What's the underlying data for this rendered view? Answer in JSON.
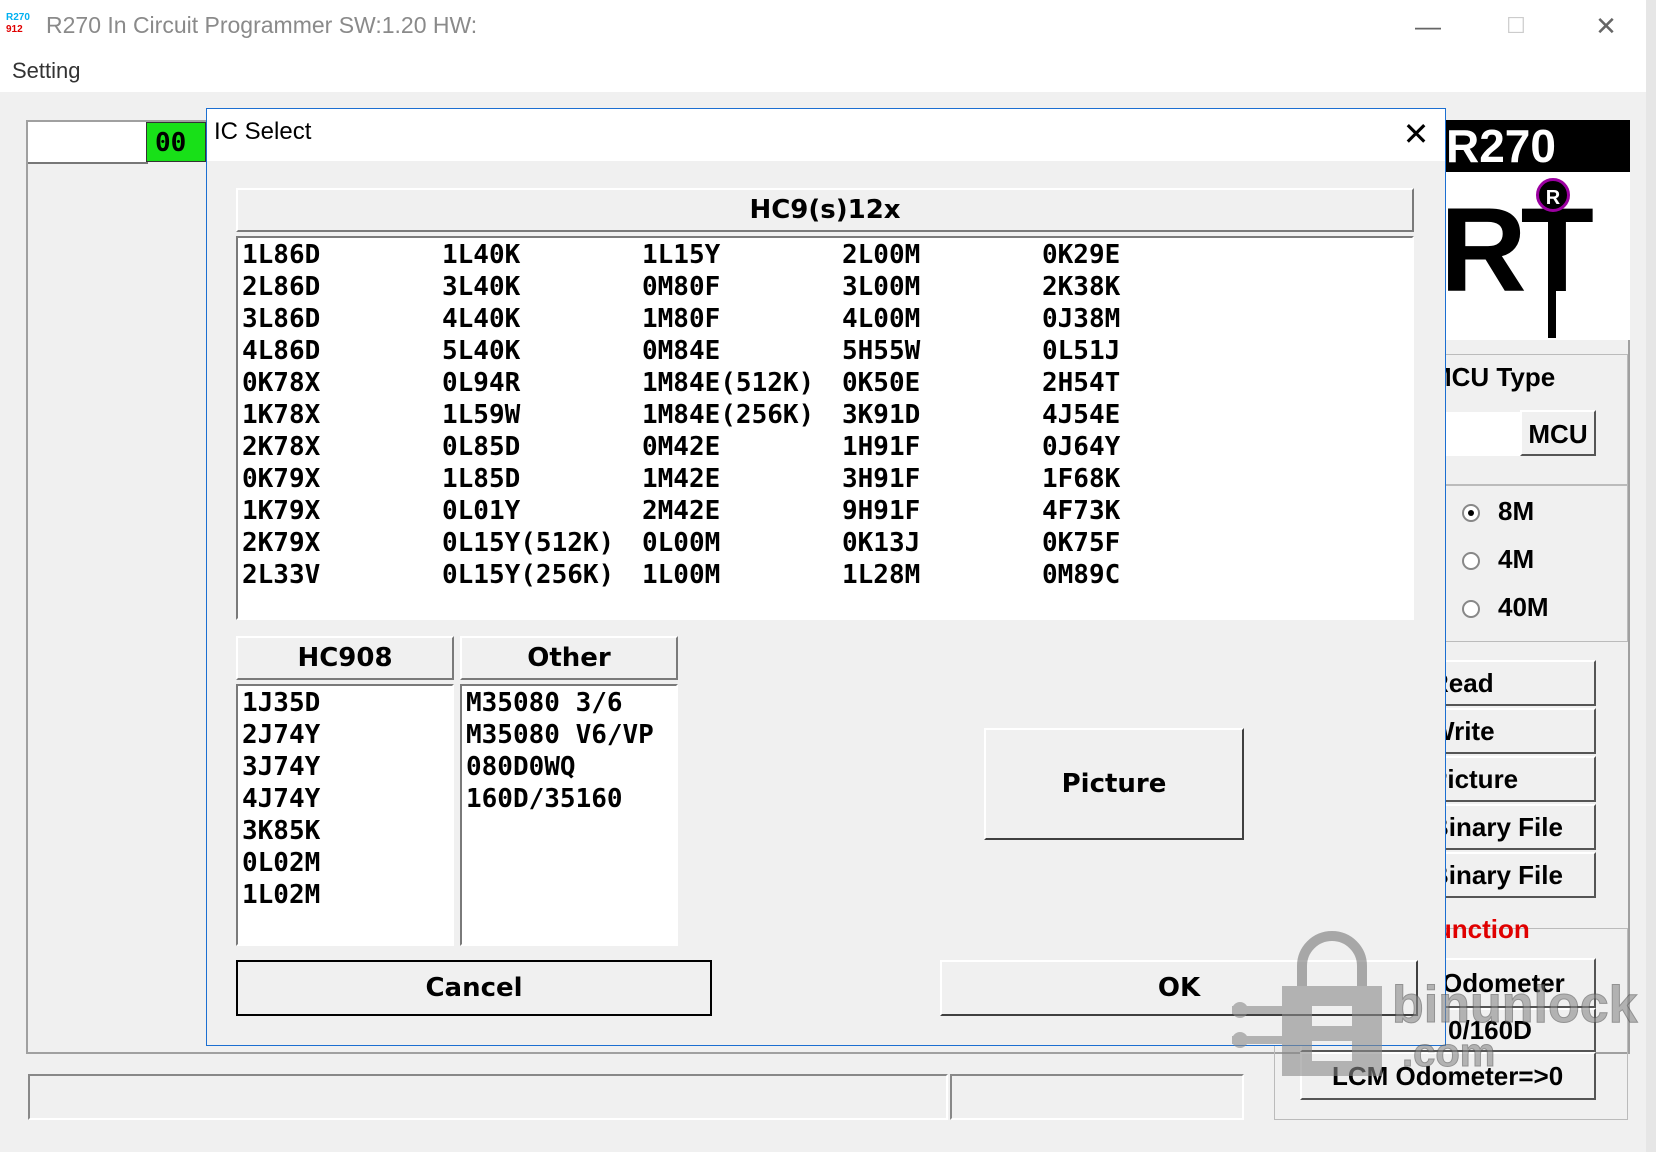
{
  "window": {
    "title": "R270 In Circuit Programmer SW:1.20 HW:",
    "icon_top": "R270",
    "icon_bottom": "912",
    "minimize": "—",
    "maximize": "☐",
    "close": "✕"
  },
  "menu": {
    "setting": "Setting"
  },
  "background": {
    "counter": "00",
    "logo_text": "R270",
    "logo_mark": "RT",
    "logo_reg": "R",
    "mcu_type_label": "MCU Type",
    "mcu_button": "MCU",
    "frequencies": [
      {
        "label": "8M",
        "selected": true
      },
      {
        "label": "4M",
        "selected": false
      },
      {
        "label": "40M",
        "selected": false
      }
    ],
    "side_buttons": [
      "Read",
      "Write",
      "Picture",
      "Binary File",
      "Binary File"
    ],
    "function_label": "Function",
    "odometer_button": "Odometer",
    "d160_button": "0/160D",
    "lcm_button": "LCM Odometer=>0"
  },
  "dialog": {
    "title": "IC Select",
    "close": "✕",
    "hc9s12x": {
      "header": "HC9(s)12x",
      "columns": [
        [
          "1L86D",
          "2L86D",
          "3L86D",
          "4L86D",
          "0K78X",
          "1K78X",
          "2K78X",
          "0K79X",
          "1K79X",
          "2K79X",
          "2L33V"
        ],
        [
          "1L40K",
          "3L40K",
          "4L40K",
          "5L40K",
          "0L94R",
          "1L59W",
          "0L85D",
          "1L85D",
          "0L01Y",
          "0L15Y(512K)",
          "0L15Y(256K)"
        ],
        [
          "1L15Y",
          "0M80F",
          "1M80F",
          "0M84E",
          "1M84E(512K)",
          "1M84E(256K)",
          "0M42E",
          "1M42E",
          "2M42E",
          "0L00M",
          "1L00M"
        ],
        [
          "2L00M",
          "3L00M",
          "4L00M",
          "5H55W",
          "0K50E",
          "3K91D",
          "1H91F",
          "3H91F",
          "9H91F",
          "0K13J",
          "1L28M"
        ],
        [
          "0K29E",
          "2K38K",
          "0J38M",
          "0L51J",
          "2H54T",
          "4J54E",
          "0J64Y",
          "1F68K",
          "4F73K",
          "0K75F",
          "0M89C"
        ]
      ]
    },
    "hc908": {
      "header": "HC908",
      "items": [
        "1J35D",
        "2J74Y",
        "3J74Y",
        "4J74Y",
        "3K85K",
        "0L02M",
        "1L02M"
      ]
    },
    "other": {
      "header": "Other",
      "items": [
        "M35080 3/6",
        "M35080 V6/VP",
        "080D0WQ",
        "160D/35160"
      ]
    },
    "picture_button": "Picture",
    "cancel_button": "Cancel",
    "ok_button": "OK"
  },
  "watermark": {
    "text": "binunlock",
    "subtext": ".com"
  },
  "colors": {
    "counter_green": "#18e018",
    "function_red": "#e00000",
    "dialog_border": "#1c6fd1"
  }
}
